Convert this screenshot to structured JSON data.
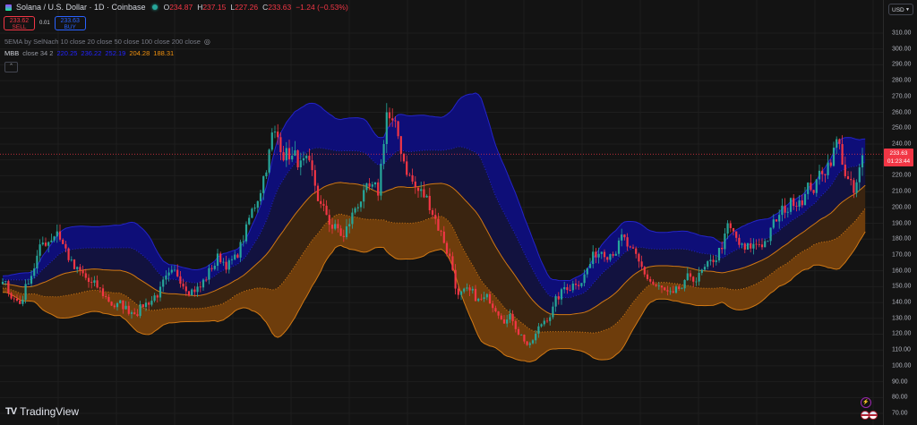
{
  "header": {
    "title": "Solana / U.S. Dollar · 1D · Coinbase",
    "ohlc": {
      "o_label": "O",
      "o": "234.87",
      "h_label": "H",
      "h": "237.15",
      "l_label": "L",
      "l": "227.26",
      "c_label": "C",
      "c": "233.63",
      "change": "−1.24 (−0.53%)"
    }
  },
  "trade": {
    "sell_price": "233.62",
    "sell_label": "SELL",
    "spread": "0.01",
    "buy_price": "233.63",
    "buy_label": "BUY"
  },
  "indicators": {
    "ema_label": "5EMA by SelNach 10 close 20 close 50 close 100 close 200 close",
    "mbb_name": "MBB",
    "mbb_params": "close 34 2",
    "mbb_values": [
      "220.25",
      "236.22",
      "252.19",
      "204.28",
      "188.31"
    ],
    "mbb_colors": [
      "#2323ff",
      "#2323ff",
      "#2323ff",
      "#f0900e",
      "#f0900e"
    ]
  },
  "price_axis": {
    "currency": "USD",
    "ticks": [
      "310.00",
      "300.00",
      "290.00",
      "280.00",
      "270.00",
      "260.00",
      "250.00",
      "240.00",
      "230.00",
      "220.00",
      "210.00",
      "200.00",
      "190.00",
      "180.00",
      "170.00",
      "160.00",
      "150.00",
      "140.00",
      "130.00",
      "120.00",
      "110.00",
      "100.00",
      "90.00",
      "80.00",
      "70.00"
    ],
    "last_price": "233.63",
    "countdown": "01:23:44"
  },
  "branding": {
    "logo_text": "TradingView"
  },
  "colors": {
    "up": "#26a69a",
    "down": "#f23645",
    "band_outer_upper": "#0e0e78",
    "band_inner_upper": "#12123f",
    "band_inner_lower": "#3a2410",
    "band_outer_lower": "#6e3d0c",
    "band_line_blue": "#2424c8",
    "band_line_orange": "#d07814"
  },
  "chart_data": {
    "type": "candlestick",
    "symbol": "SOLUSD",
    "interval": "1D",
    "ylim": [
      70,
      310
    ],
    "grid": true,
    "indicator": "MBB close 34 2",
    "keypoints_bar": [
      0,
      6,
      12,
      19,
      25,
      31,
      38,
      44,
      50,
      56,
      62,
      69,
      75,
      81,
      88,
      94,
      100,
      106,
      112,
      119,
      125,
      131,
      134,
      138,
      144,
      150,
      156,
      159,
      166,
      172,
      178,
      184,
      191,
      197,
      203,
      209,
      216,
      222,
      228,
      234,
      241,
      247,
      253,
      259,
      266,
      272,
      278,
      284,
      291,
      297,
      301
    ],
    "keypoints_close": [
      150,
      140,
      170,
      188,
      160,
      150,
      140,
      135,
      140,
      150,
      155,
      150,
      168,
      165,
      200,
      245,
      235,
      222,
      195,
      180,
      208,
      205,
      262,
      240,
      212,
      200,
      170,
      145,
      140,
      140,
      130,
      112,
      135,
      150,
      160,
      175,
      180,
      160,
      150,
      140,
      155,
      160,
      185,
      170,
      180,
      195,
      210,
      215,
      242,
      205,
      233.63
    ],
    "last_candle": {
      "open": 234.87,
      "high": 237.15,
      "low": 227.26,
      "close": 233.63
    }
  }
}
